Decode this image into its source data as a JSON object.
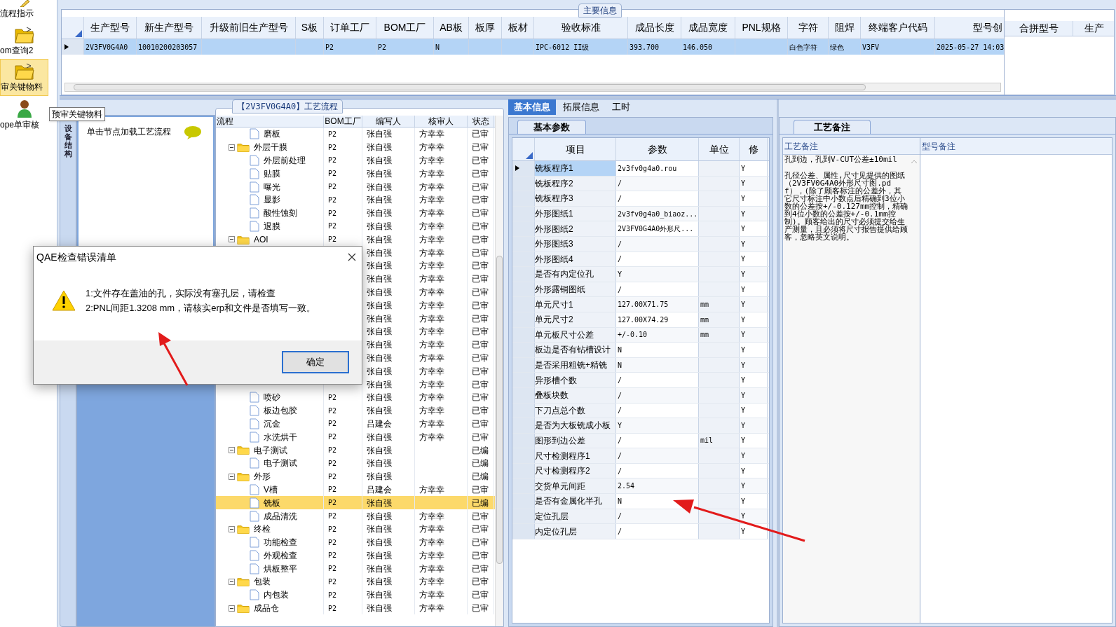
{
  "sidebar": {
    "items": [
      {
        "label": "流程指示",
        "kind": "pencil",
        "selected": false
      },
      {
        "label": "om查询2",
        "kind": "folder",
        "selected": false
      },
      {
        "label": "审关键物料",
        "kind": "folder",
        "selected": true
      },
      {
        "label": "ope单审核",
        "kind": "person",
        "selected": false
      }
    ],
    "tooltip": "预审关键物料"
  },
  "main_info": {
    "group_title": "主要信息",
    "columns": [
      "生产型号",
      "新生产型号",
      "升级前旧生产型号",
      "S板",
      "订单工厂",
      "BOM工厂",
      "AB板",
      "板厚",
      "板材",
      "验收标准",
      "成品长度",
      "成品宽度",
      "PNL规格",
      "字符",
      "阻焊",
      "终端客户代码",
      "型号创"
    ],
    "rows": [
      {
        "selected": true,
        "cells": [
          "2V3FV0G4A0",
          "10010200203057",
          "",
          "",
          "P2",
          "P2",
          "N",
          "",
          "",
          "IPC-6012 II级",
          "393.700",
          "146.050",
          "",
          "白色字符",
          "绿色",
          "V3FV",
          "2025-05-27 14:03"
        ]
      }
    ]
  },
  "merge_grid": {
    "columns": [
      "合拼型号",
      "生产"
    ]
  },
  "process": {
    "title": "【2V3FV0G4A0】工艺流程",
    "side_tab": "设备结构",
    "hint": "单击节点加载工艺流程",
    "columns": [
      "流程",
      "BOM工厂",
      "编写人",
      "核审人",
      "状态"
    ],
    "rows": [
      {
        "kind": "file",
        "name": "磨板",
        "bom": "P2",
        "writer": "张自强",
        "reviewer": "方幸幸",
        "status": "已审",
        "selected": false
      },
      {
        "kind": "folder",
        "name": "外层干膜",
        "bom": "P2",
        "writer": "张自强",
        "reviewer": "方幸幸",
        "status": "已审",
        "selected": false,
        "expanded": true,
        "children": [
          {
            "kind": "file",
            "name": "外层前处理",
            "bom": "P2",
            "writer": "张自强",
            "reviewer": "方幸幸",
            "status": "已审",
            "selected": false
          },
          {
            "kind": "file",
            "name": "贴膜",
            "bom": "P2",
            "writer": "张自强",
            "reviewer": "方幸幸",
            "status": "已审",
            "selected": false
          },
          {
            "kind": "file",
            "name": "曝光",
            "bom": "P2",
            "writer": "张自强",
            "reviewer": "方幸幸",
            "status": "已审",
            "selected": false
          },
          {
            "kind": "file",
            "name": "显影",
            "bom": "P2",
            "writer": "张自强",
            "reviewer": "方幸幸",
            "status": "已审",
            "selected": false
          },
          {
            "kind": "file",
            "name": "酸性蚀刻",
            "bom": "P2",
            "writer": "张自强",
            "reviewer": "方幸幸",
            "status": "已审",
            "selected": false
          },
          {
            "kind": "file",
            "name": "退膜",
            "bom": "P2",
            "writer": "张自强",
            "reviewer": "方幸幸",
            "status": "已审",
            "selected": false
          }
        ]
      },
      {
        "kind": "folder",
        "name": "AOI",
        "bom": "P2",
        "writer": "张自强",
        "reviewer": "方幸幸",
        "status": "已审",
        "selected": false,
        "expanded": true,
        "children": [
          {
            "writer": "张自强",
            "reviewer": "方幸幸",
            "status": "已审",
            "selected": false
          },
          {
            "writer": "张自强",
            "reviewer": "方幸幸",
            "status": "已审",
            "selected": false
          },
          {
            "writer": "张自强",
            "reviewer": "方幸幸",
            "status": "已审",
            "selected": false
          },
          {
            "writer": "张自强",
            "reviewer": "方幸幸",
            "status": "已审",
            "selected": false
          },
          {
            "writer": "张自强",
            "reviewer": "方幸幸",
            "status": "已审",
            "selected": false
          },
          {
            "writer": "张自强",
            "reviewer": "方幸幸",
            "status": "已审",
            "selected": false
          },
          {
            "writer": "张自强",
            "reviewer": "方幸幸",
            "status": "已审",
            "selected": false
          },
          {
            "writer": "张自强",
            "reviewer": "方幸幸",
            "status": "已审",
            "selected": false
          },
          {
            "writer": "张自强",
            "reviewer": "方幸幸",
            "status": "已审",
            "selected": false
          },
          {
            "writer": "张自强",
            "reviewer": "方幸幸",
            "status": "已审",
            "selected": false
          }
        ]
      },
      {
        "writer": "张自强",
        "reviewer": "方幸幸",
        "status": "已审",
        "selected": false,
        "children": [
          {
            "kind": "file",
            "name": "喷砂",
            "bom": "P2",
            "writer": "张自强",
            "reviewer": "方幸幸",
            "status": "已审",
            "selected": false
          },
          {
            "kind": "file",
            "name": "板边包胶",
            "bom": "P2",
            "writer": "张自强",
            "reviewer": "方幸幸",
            "status": "已审",
            "selected": false
          },
          {
            "kind": "file",
            "name": "沉金",
            "bom": "P2",
            "writer": "吕建会",
            "reviewer": "方幸幸",
            "status": "已审",
            "selected": false
          },
          {
            "kind": "file",
            "name": "水洗烘干",
            "bom": "P2",
            "writer": "张自强",
            "reviewer": "方幸幸",
            "status": "已审",
            "selected": false
          }
        ]
      },
      {
        "kind": "folder",
        "name": "电子测试",
        "bom": "P2",
        "writer": "张自强",
        "status": "已编",
        "selected": false,
        "expanded": true,
        "children": [
          {
            "kind": "file",
            "name": "电子测试",
            "bom": "P2",
            "writer": "张自强",
            "status": "已编",
            "selected": false
          }
        ]
      },
      {
        "kind": "folder",
        "name": "外形",
        "bom": "P2",
        "writer": "张自强",
        "status": "已编",
        "selected": false,
        "expanded": true,
        "children": [
          {
            "kind": "file",
            "name": "V槽",
            "bom": "P2",
            "writer": "吕建会",
            "reviewer": "方幸幸",
            "status": "已审",
            "selected": false
          },
          {
            "kind": "file",
            "name": "铣板",
            "bom": "P2",
            "writer": "张自强",
            "status": "已编",
            "selected": true
          },
          {
            "kind": "file",
            "name": "成品清洗",
            "bom": "P2",
            "writer": "张自强",
            "reviewer": "方幸幸",
            "status": "已审",
            "selected": false
          }
        ]
      },
      {
        "kind": "folder",
        "name": "终检",
        "bom": "P2",
        "writer": "张自强",
        "reviewer": "方幸幸",
        "status": "已审",
        "selected": false,
        "expanded": true,
        "children": [
          {
            "kind": "file",
            "name": "功能检查",
            "bom": "P2",
            "writer": "张自强",
            "reviewer": "方幸幸",
            "status": "已审",
            "selected": false
          },
          {
            "kind": "file",
            "name": "外观检查",
            "bom": "P2",
            "writer": "张自强",
            "reviewer": "方幸幸",
            "status": "已审",
            "selected": false
          },
          {
            "kind": "file",
            "name": "烘板整平",
            "bom": "P2",
            "writer": "张自强",
            "reviewer": "方幸幸",
            "status": "已审",
            "selected": false
          }
        ]
      },
      {
        "kind": "folder",
        "name": "包装",
        "bom": "P2",
        "writer": "张自强",
        "reviewer": "方幸幸",
        "status": "已审",
        "selected": false,
        "expanded": true,
        "children": [
          {
            "kind": "file",
            "name": "内包装",
            "bom": "P2",
            "writer": "张自强",
            "reviewer": "方幸幸",
            "status": "已审",
            "selected": false
          }
        ]
      },
      {
        "kind": "folder",
        "name": "成品仓",
        "bom": "P2",
        "writer": "张自强",
        "reviewer": "方幸幸",
        "status": "已审",
        "selected": false,
        "expanded": true
      }
    ]
  },
  "detail": {
    "tabs": [
      {
        "label": "基本信息",
        "selected": true
      },
      {
        "label": "拓展信息",
        "selected": false
      },
      {
        "label": "工时",
        "selected": false
      }
    ],
    "subtab": "基本参数",
    "columns": [
      "项目",
      "参数",
      "单位",
      "修"
    ],
    "rows": [
      {
        "item": "铣板程序1",
        "value": "2v3fv0g4a0.rou",
        "unit": "",
        "modified": "Y",
        "selected": true
      },
      {
        "item": "铣板程序2",
        "value": "/",
        "unit": "",
        "modified": "Y",
        "selected": false
      },
      {
        "item": "铣板程序3",
        "value": "/",
        "unit": "",
        "modified": "Y",
        "selected": false
      },
      {
        "item": "外形图纸1",
        "value": "2v3fv0g4a0_biaoz...",
        "unit": "",
        "modified": "Y",
        "selected": false
      },
      {
        "item": "外形图纸2",
        "value": "2V3FV0G4A0外形尺...",
        "unit": "",
        "modified": "Y",
        "selected": false
      },
      {
        "item": "外形图纸3",
        "value": "/",
        "unit": "",
        "modified": "Y",
        "selected": false
      },
      {
        "item": "外形图纸4",
        "value": "/",
        "unit": "",
        "modified": "Y",
        "selected": false
      },
      {
        "item": "是否有内定位孔",
        "value": "Y",
        "unit": "",
        "modified": "Y",
        "selected": false
      },
      {
        "item": "外形露铜图纸",
        "value": "/",
        "unit": "",
        "modified": "Y",
        "selected": false
      },
      {
        "item": "单元尺寸1",
        "value": "127.00X71.75",
        "unit": "mm",
        "modified": "Y",
        "selected": false
      },
      {
        "item": "单元尺寸2",
        "value": "127.00X74.29",
        "unit": "mm",
        "modified": "Y",
        "selected": false
      },
      {
        "item": "单元板尺寸公差",
        "value": "+/-0.10",
        "unit": "mm",
        "modified": "Y",
        "selected": false
      },
      {
        "item": "板边是否有钻槽设计",
        "value": "N",
        "unit": "",
        "modified": "Y",
        "selected": false
      },
      {
        "item": "是否采用粗铣+精铣",
        "value": "N",
        "unit": "",
        "modified": "Y",
        "selected": false
      },
      {
        "item": "异形槽个数",
        "value": "/",
        "unit": "",
        "modified": "Y",
        "selected": false
      },
      {
        "item": "叠板块数",
        "value": "/",
        "unit": "",
        "modified": "Y",
        "selected": false
      },
      {
        "item": "下刀点总个数",
        "value": "/",
        "unit": "",
        "modified": "Y",
        "selected": false
      },
      {
        "item": "是否为大板铣成小板",
        "value": "Y",
        "unit": "",
        "modified": "Y",
        "selected": false
      },
      {
        "item": "图形到边公差",
        "value": "/",
        "unit": "mil",
        "modified": "Y",
        "selected": false
      },
      {
        "item": "尺寸检测程序1",
        "value": "/",
        "unit": "",
        "modified": "Y",
        "selected": false
      },
      {
        "item": "尺寸检测程序2",
        "value": "/",
        "unit": "",
        "modified": "Y",
        "selected": false
      },
      {
        "item": "交货单元间距",
        "value": "2.54",
        "unit": "",
        "modified": "Y",
        "selected": false
      },
      {
        "item": "是否有金属化半孔",
        "value": "N",
        "unit": "",
        "modified": "Y",
        "selected": false
      },
      {
        "item": "定位孔层",
        "value": "/",
        "unit": "",
        "modified": "Y",
        "selected": false
      },
      {
        "item": "内定位孔层",
        "value": "/",
        "unit": "",
        "modified": "Y",
        "selected": false
      }
    ]
  },
  "notes": {
    "tab": "工艺备注",
    "columns": [
      "工艺备注",
      "型号备注"
    ],
    "paragraphs": [
      "孔到边，孔到V-CUT公差±10mil",
      "孔径公差、属性,尺寸见提供的图纸（2V3FV0G4A0外形尺寸图.pdf），(除了顾客标注的公差外，其它尺寸标注中小数点后精确到3位小数的公差按+/-0.127mm控制，精确到4位小数的公差按+/-0.1mm控制)。顾客给出的尺寸必须提交给生产测量，且必须将尺寸报告提供给顾客，忽略英文说明。"
    ]
  },
  "dialog": {
    "title": "QAE检查错误清单",
    "messages": [
      "1:文件存在盖油的孔，实际没有塞孔层，请检查",
      "2:PNL间距1.3208 mm，请核实erp和文件是否填写一致。"
    ],
    "button": "确定"
  }
}
